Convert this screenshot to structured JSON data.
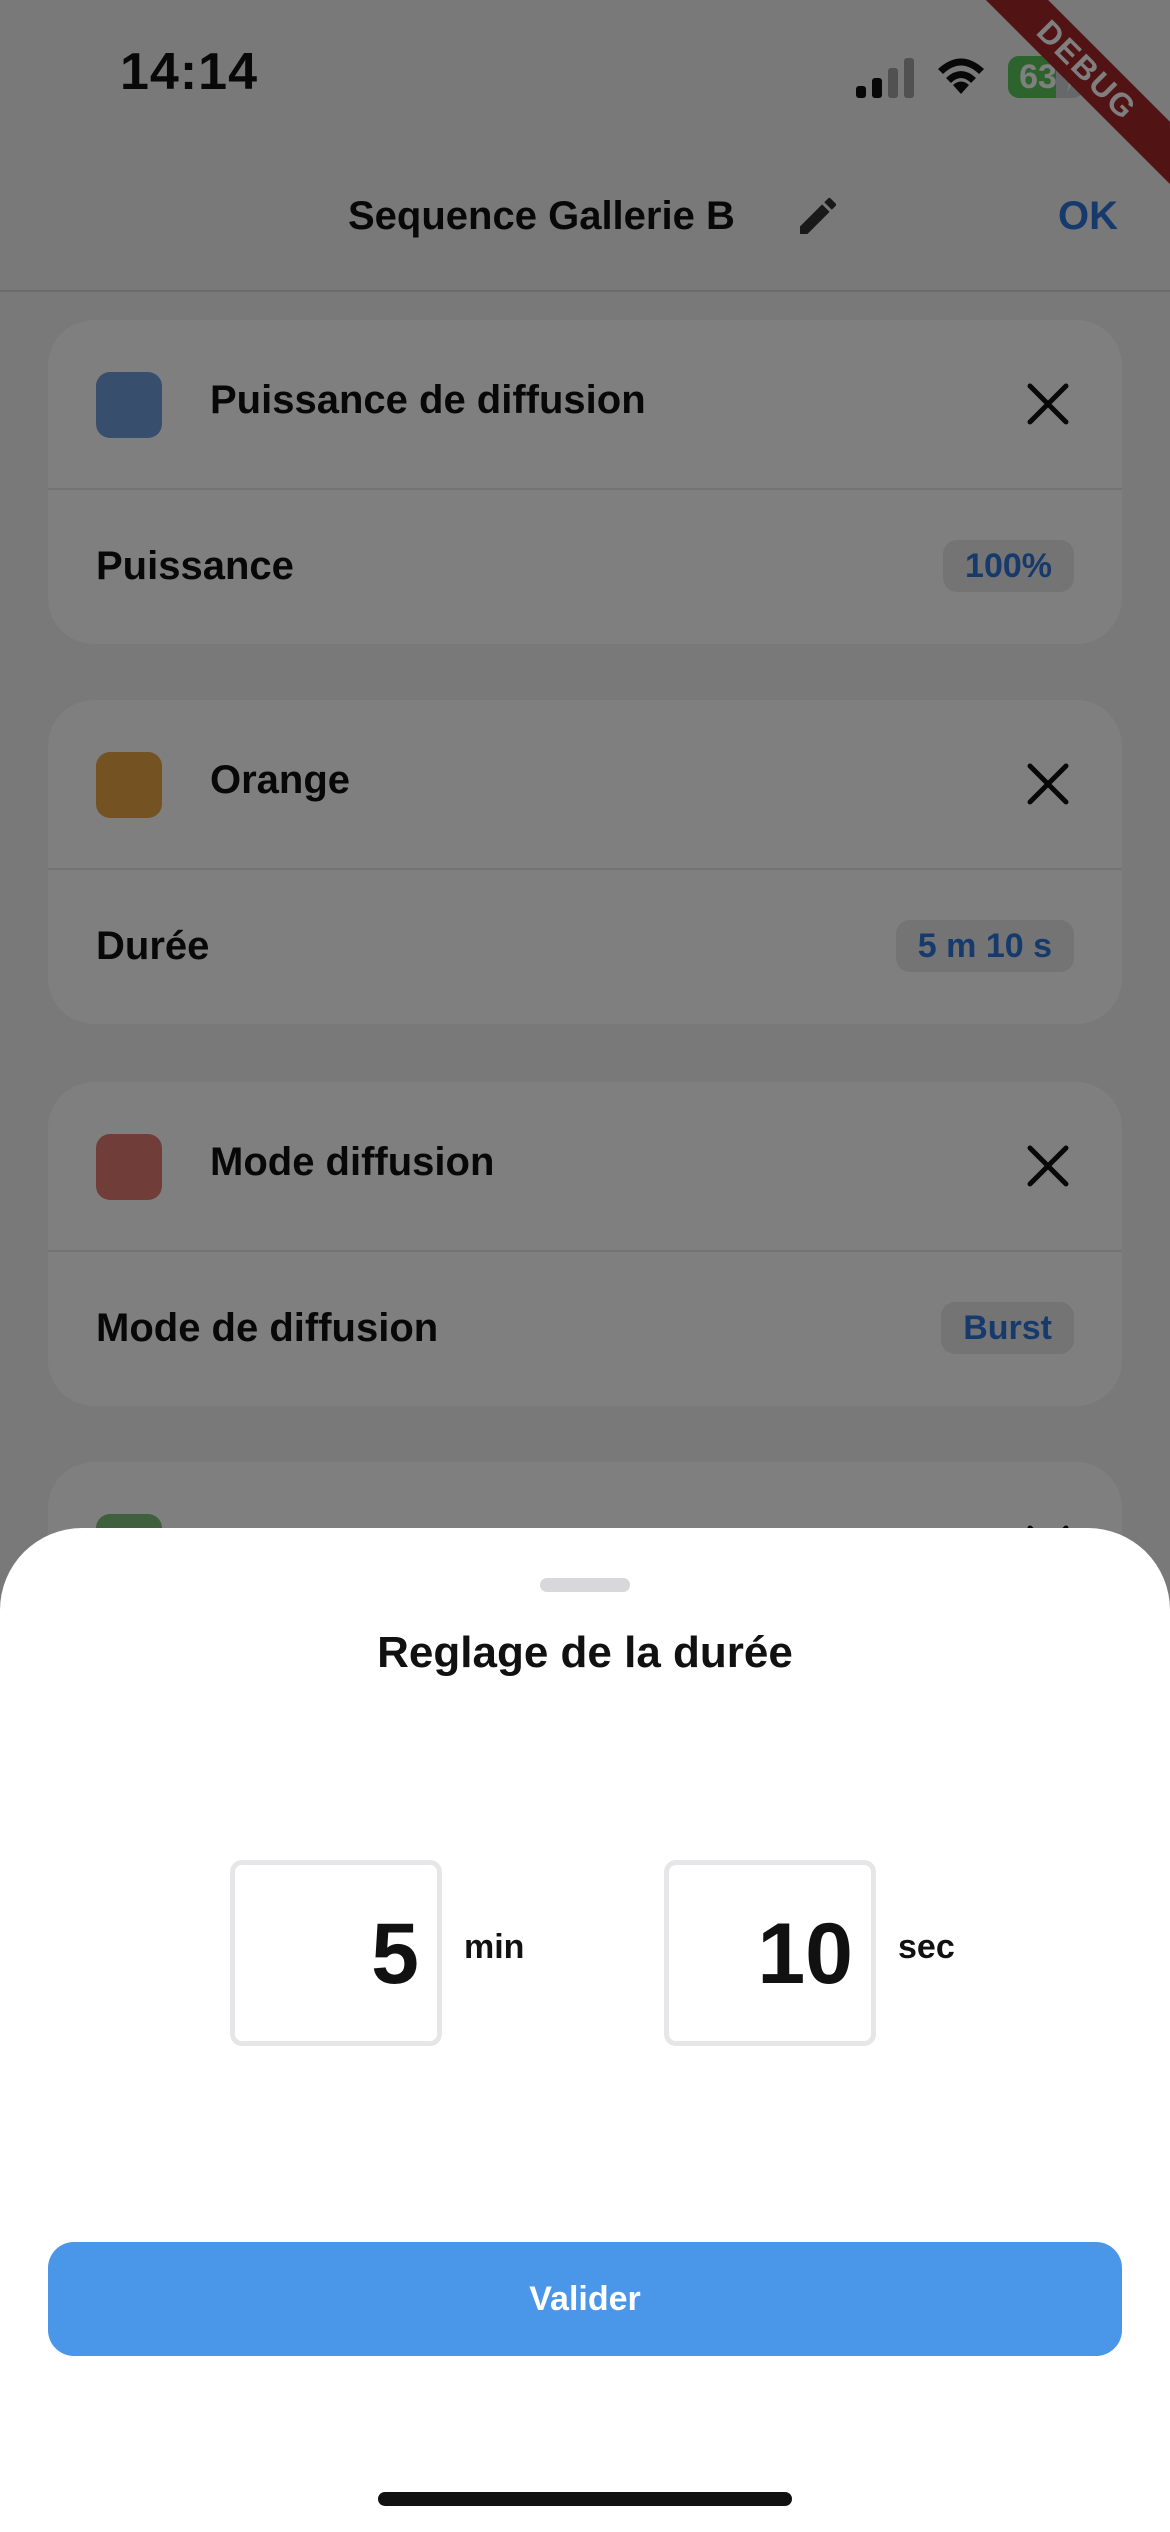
{
  "status_bar": {
    "time": "14:14",
    "battery": "63",
    "battery_level": 0.63,
    "debug_label": "DEBUG"
  },
  "navbar": {
    "title": "Sequence Gallerie B",
    "ok_label": "OK"
  },
  "cards": [
    {
      "title": "Puissance de diffusion",
      "swatch_color": "#6f9ed8",
      "label": "Puissance",
      "value": "100%"
    },
    {
      "title": "Orange",
      "swatch_color": "#e8a544",
      "label": "Durée",
      "value": "5 m 10 s"
    },
    {
      "title": "Mode diffusion",
      "swatch_color": "#e07a73",
      "label": "Mode de diffusion",
      "value": "Burst"
    },
    {
      "title": "",
      "swatch_color": "#7fc07a",
      "label": "",
      "value": ""
    }
  ],
  "sheet": {
    "title": "Reglage de la durée",
    "minutes_value": "5",
    "minutes_unit": "min",
    "seconds_value": "10",
    "seconds_unit": "sec",
    "validate_label": "Valider"
  },
  "colors": {
    "accent": "#2d74d9",
    "button": "#4a96e8",
    "debug": "#a5262a"
  },
  "icons": [
    "edit-icon",
    "close-icon",
    "signal-icon",
    "wifi-icon",
    "battery-icon"
  ]
}
